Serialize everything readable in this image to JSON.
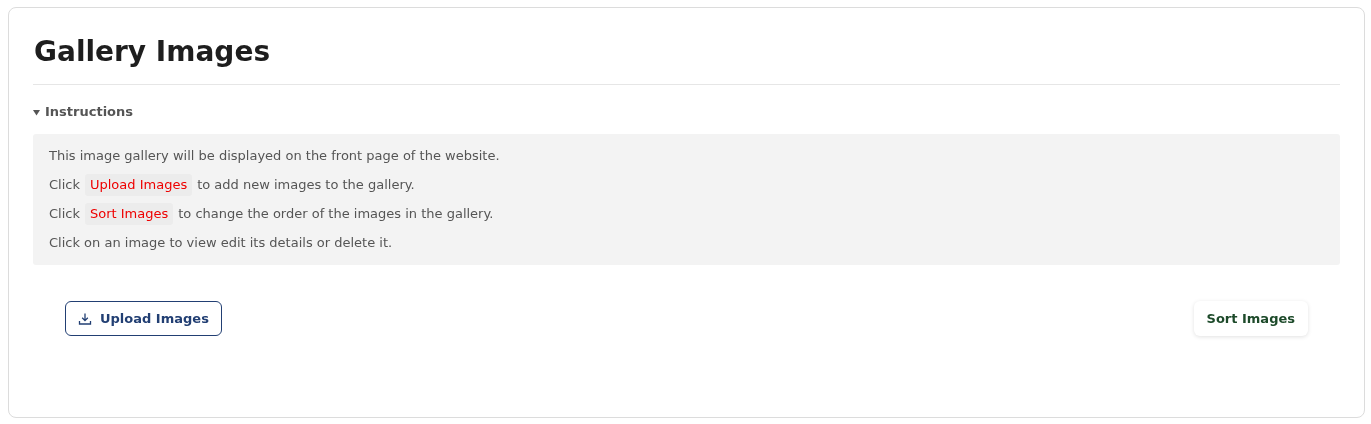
{
  "title": "Gallery Images",
  "instructions": {
    "label": "Instructions",
    "expanded": true,
    "lines": [
      [
        {
          "kind": "text",
          "text": "This image gallery will be displayed on the front page of the website."
        }
      ],
      [
        {
          "kind": "text",
          "text": "Click"
        },
        {
          "kind": "code",
          "text": "Upload Images"
        },
        {
          "kind": "text",
          "text": "to add new images to the gallery."
        }
      ],
      [
        {
          "kind": "text",
          "text": "Click"
        },
        {
          "kind": "code",
          "text": "Sort Images"
        },
        {
          "kind": "text",
          "text": "to change the order of the images in the gallery."
        }
      ],
      [
        {
          "kind": "text",
          "text": "Click on an image to view edit its details or delete it."
        }
      ]
    ]
  },
  "buttons": {
    "upload": "Upload Images",
    "sort": "Sort Images"
  }
}
